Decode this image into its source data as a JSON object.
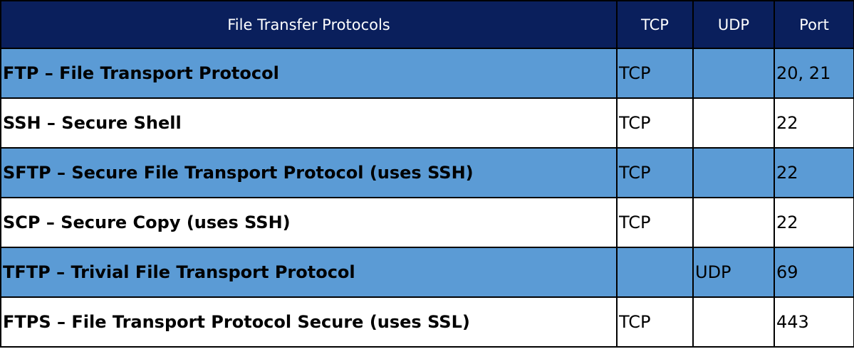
{
  "table": {
    "headers": {
      "protocol": "File Transfer Protocols",
      "tcp": "TCP",
      "udp": "UDP",
      "port": "Port"
    },
    "rows": [
      {
        "protocol": "FTP – File Transport Protocol",
        "tcp": "TCP",
        "udp": "",
        "port": "20, 21"
      },
      {
        "protocol": "SSH – Secure Shell",
        "tcp": "TCP",
        "udp": "",
        "port": "22"
      },
      {
        "protocol": "SFTP – Secure File Transport Protocol (uses SSH)",
        "tcp": "TCP",
        "udp": "",
        "port": "22"
      },
      {
        "protocol": "SCP – Secure Copy (uses SSH)",
        "tcp": "TCP",
        "udp": "",
        "port": "22"
      },
      {
        "protocol": "TFTP – Trivial File Transport Protocol",
        "tcp": "",
        "udp": "UDP",
        "port": "69"
      },
      {
        "protocol": "FTPS – File Transport Protocol Secure (uses SSL)",
        "tcp": "TCP",
        "udp": "",
        "port": "443"
      }
    ]
  },
  "colors": {
    "header_background": "#0a1f5c",
    "header_text": "#ffffff",
    "shaded_row": "#5b9bd5",
    "plain_row": "#ffffff",
    "border": "#000000"
  }
}
